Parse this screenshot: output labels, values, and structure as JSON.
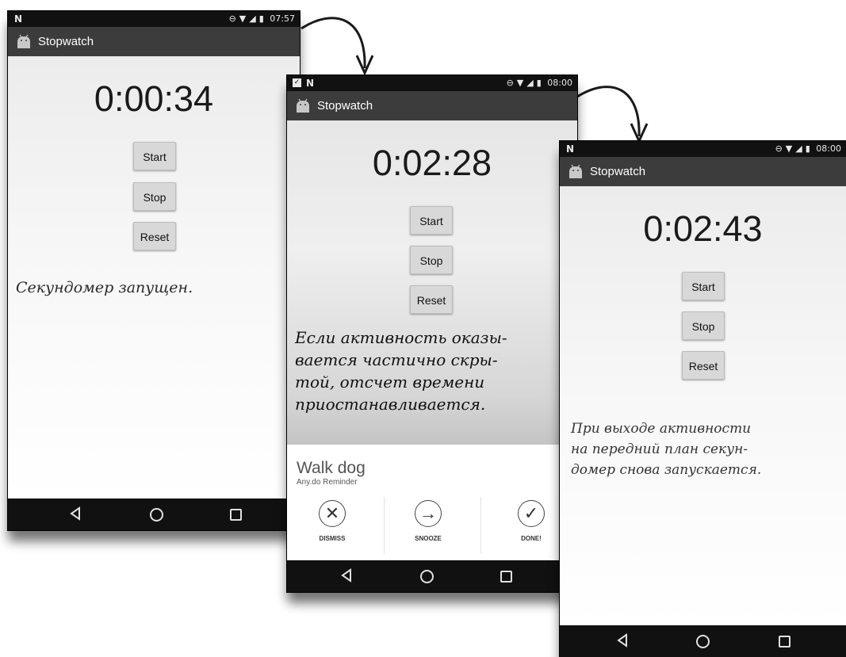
{
  "phones": [
    {
      "status_time": "07:57",
      "app_title": "Stopwatch",
      "timer": "0:00:34",
      "buttons": {
        "start": "Start",
        "stop": "Stop",
        "reset": "Reset"
      }
    },
    {
      "status_time": "08:00",
      "app_title": "Stopwatch",
      "timer": "0:02:28",
      "buttons": {
        "start": "Start",
        "stop": "Stop",
        "reset": "Reset"
      },
      "notification": {
        "title": "Walk dog",
        "subtitle": "Any.do Reminder",
        "actions": {
          "dismiss": "DISMISS",
          "snooze": "SNOOZE",
          "done": "DONE!"
        }
      }
    },
    {
      "status_time": "08:00",
      "app_title": "Stopwatch",
      "timer": "0:02:43",
      "buttons": {
        "start": "Start",
        "stop": "Stop",
        "reset": "Reset"
      }
    }
  ],
  "annotations": {
    "first": "Секундомер запущен.",
    "second": [
      "Если активность оказы-",
      "вается частично скры-",
      "той, отсчет времени",
      "приостанавливается."
    ],
    "third": [
      "При выходе активности",
      "на передний план секун-",
      "домер снова запускается."
    ]
  },
  "icons": {
    "status_left": "n-icon",
    "status_right": [
      "dnd-icon",
      "wifi-icon",
      "signal-icon",
      "battery-icon"
    ],
    "nav": [
      "back-icon",
      "home-icon",
      "recents-icon"
    ]
  }
}
